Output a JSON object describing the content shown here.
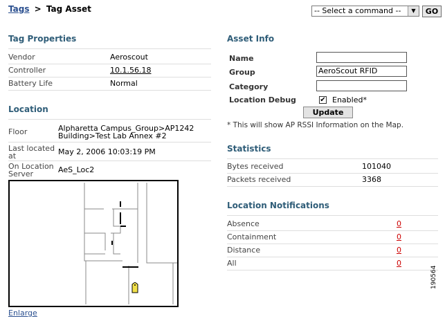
{
  "breadcrumb": {
    "link": "Tags",
    "separator": ">",
    "current": "Tag Asset"
  },
  "command": {
    "selected": "-- Select a command --",
    "go_label": "GO"
  },
  "tag_properties": {
    "title": "Tag Properties",
    "rows": [
      {
        "label": "Vendor",
        "value": "Aeroscout"
      },
      {
        "label": "Controller",
        "value": "10.1.56.18"
      },
      {
        "label": "Battery Life",
        "value": "Normal"
      }
    ]
  },
  "location": {
    "title": "Location",
    "floor_label": "Floor",
    "floor_line1": "Alpharetta Campus_Group>AP1242",
    "floor_line2": "Building>Test Lab Annex #2",
    "last_located_label_1": "Last located",
    "last_located_label_2": "at",
    "last_located_value": "May 2, 2006 10:03:19 PM",
    "server_label_1": "On Location",
    "server_label_2": "Server",
    "server_value": "AeS_Loc2",
    "map_tag_icon": "tag-marker-icon",
    "enlarge_label": "Enlarge"
  },
  "asset_info": {
    "title": "Asset Info",
    "name_label": "Name",
    "name_value": "",
    "group_label": "Group",
    "group_value": "AeroScout RFID",
    "category_label": "Category",
    "category_value": "",
    "debug_label": "Location Debug",
    "debug_checked": true,
    "debug_checkmark": "✔",
    "debug_option": "Enabled*",
    "update_label": "Update",
    "note": "* This will show AP RSSI Information on the Map."
  },
  "statistics": {
    "title": "Statistics",
    "rows": [
      {
        "label": "Bytes received",
        "value": "101040"
      },
      {
        "label": "Packets received",
        "value": "3368"
      }
    ]
  },
  "notifications": {
    "title": "Location Notifications",
    "rows": [
      {
        "label": "Absence",
        "count": "0"
      },
      {
        "label": "Containment",
        "count": "0"
      },
      {
        "label": "Distance",
        "count": "0"
      },
      {
        "label": "All",
        "count": "0"
      }
    ]
  },
  "figure_number": "190564",
  "colors": {
    "section_title": "#2f5d78",
    "link": "#2a4f8f",
    "notification_count": "#cc0000",
    "tag_marker": "#f1e04a"
  }
}
